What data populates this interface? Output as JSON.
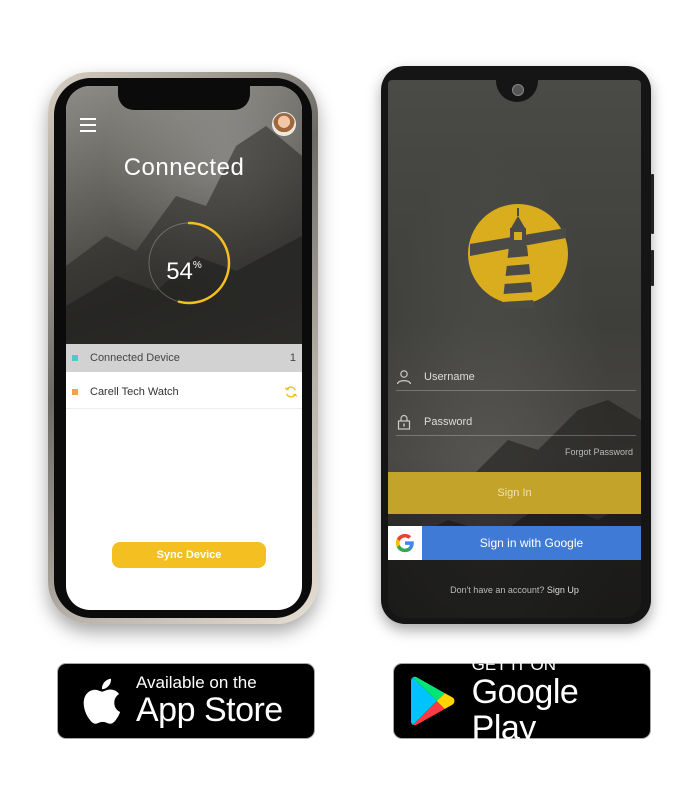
{
  "ios_app": {
    "title": "Connected",
    "progress_value": "54",
    "progress_unit": "%",
    "progress_fraction": 0.54,
    "connected_row": {
      "label": "Connected Device",
      "count": "1"
    },
    "device_row": {
      "label": "Carell Tech Watch"
    },
    "sync_button": "Sync Device",
    "colors": {
      "accent": "#f4bf20",
      "connected_dot": "#4fc9c9",
      "device_dot": "#f4a24a"
    }
  },
  "android_app": {
    "username_placeholder": "Username",
    "password_placeholder": "Password",
    "forgot_password": "Forgot Password",
    "sign_in": "Sign In",
    "google_sign_in": "Sign in with Google",
    "no_account": "Don't have an account?",
    "sign_up": "Sign Up",
    "colors": {
      "brand": "#c4a32a",
      "google": "#3f7bd6"
    },
    "icons": [
      "user-icon",
      "lock-icon",
      "google-icon",
      "lighthouse-logo"
    ]
  },
  "badges": {
    "app_store": {
      "small": "Available on the",
      "big": "App Store"
    },
    "google_play": {
      "small": "GET IT ON",
      "big": "Google Play"
    }
  }
}
